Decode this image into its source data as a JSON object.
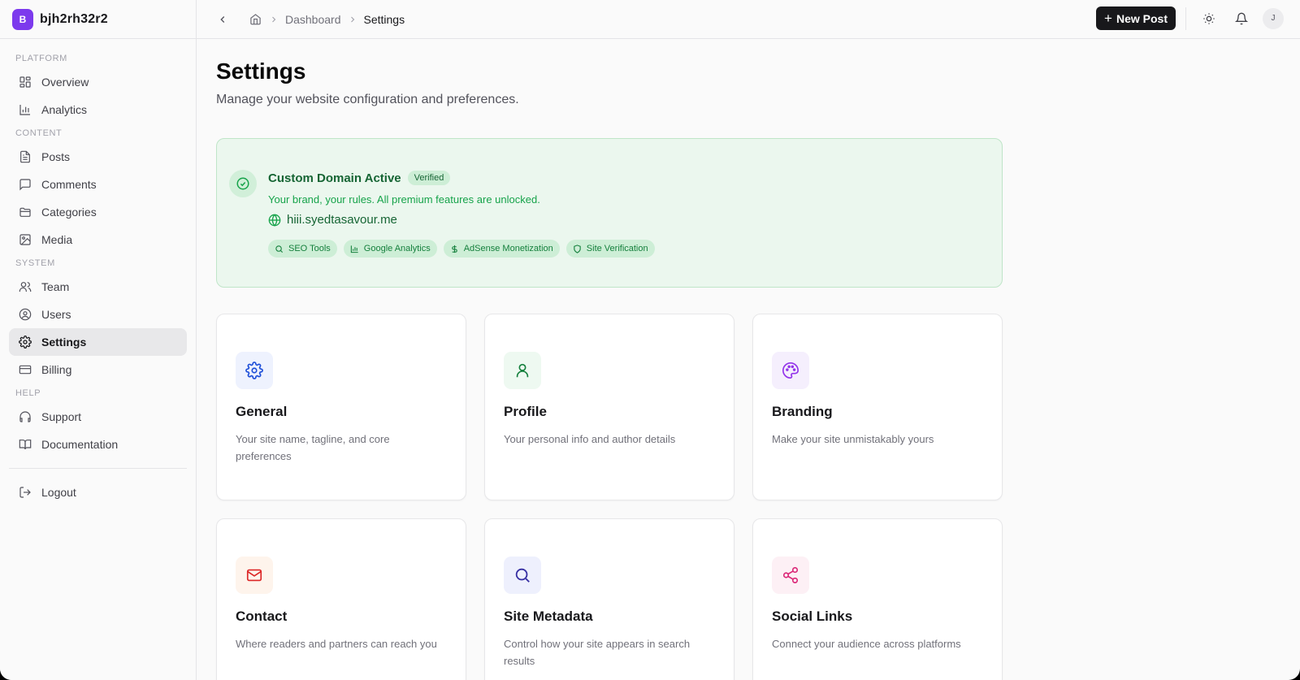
{
  "brand": {
    "initial": "B",
    "name": "bjh2rh32r2",
    "color": "#7c3aed"
  },
  "sidebar": {
    "sections": [
      {
        "label": "PLATFORM",
        "items": [
          {
            "label": "Overview",
            "icon": "grid-icon"
          },
          {
            "label": "Analytics",
            "icon": "bar-chart-icon"
          }
        ]
      },
      {
        "label": "CONTENT",
        "items": [
          {
            "label": "Posts",
            "icon": "file-text-icon"
          },
          {
            "label": "Comments",
            "icon": "message-square-icon"
          },
          {
            "label": "Categories",
            "icon": "folder-icon"
          },
          {
            "label": "Media",
            "icon": "image-icon"
          }
        ]
      },
      {
        "label": "SYSTEM",
        "items": [
          {
            "label": "Team",
            "icon": "users-icon"
          },
          {
            "label": "Users",
            "icon": "user-circle-icon"
          },
          {
            "label": "Settings",
            "icon": "gear-icon",
            "active": true
          },
          {
            "label": "Billing",
            "icon": "credit-card-icon"
          }
        ]
      },
      {
        "label": "HELP",
        "items": [
          {
            "label": "Support",
            "icon": "headphones-icon"
          },
          {
            "label": "Documentation",
            "icon": "book-icon"
          }
        ]
      }
    ],
    "logout": {
      "label": "Logout",
      "icon": "logout-icon"
    }
  },
  "topbar": {
    "breadcrumb": [
      "Dashboard",
      "Settings"
    ],
    "new_post_label": "New Post",
    "avatar_initial": "J"
  },
  "page": {
    "title": "Settings",
    "subtitle": "Manage your website configuration and preferences."
  },
  "domain": {
    "title": "Custom Domain Active",
    "badge": "Verified",
    "description": "Your brand, your rules. All premium features are unlocked.",
    "url": "hiii.syedtasavour.me",
    "features": [
      {
        "label": "SEO Tools",
        "icon": "search-icon"
      },
      {
        "label": "Google Analytics",
        "icon": "bar-chart-icon"
      },
      {
        "label": "AdSense Monetization",
        "icon": "dollar-icon"
      },
      {
        "label": "Site Verification",
        "icon": "shield-icon"
      }
    ]
  },
  "cards": [
    {
      "title": "General",
      "description": "Your site name, tagline, and core preferences",
      "icon": "gear-icon",
      "color": "#1d4ed8",
      "bg": "#eef2fe"
    },
    {
      "title": "Profile",
      "description": "Your personal info and author details",
      "icon": "user-icon",
      "color": "#15803d",
      "bg": "#eef9f1"
    },
    {
      "title": "Branding",
      "description": "Make your site unmistakably yours",
      "icon": "palette-icon",
      "color": "#9333ea",
      "bg": "#f5effd"
    },
    {
      "title": "Contact",
      "description": "Where readers and partners can reach you",
      "icon": "mail-icon",
      "color": "#dc2626",
      "bg": "#fef4ec"
    },
    {
      "title": "Site Metadata",
      "description": "Control how your site appears in search results",
      "icon": "search-icon",
      "color": "#3730a3",
      "bg": "#eef0fd"
    },
    {
      "title": "Social Links",
      "description": "Connect your audience across platforms",
      "icon": "share-icon",
      "color": "#db2777",
      "bg": "#fdf0f5"
    }
  ]
}
